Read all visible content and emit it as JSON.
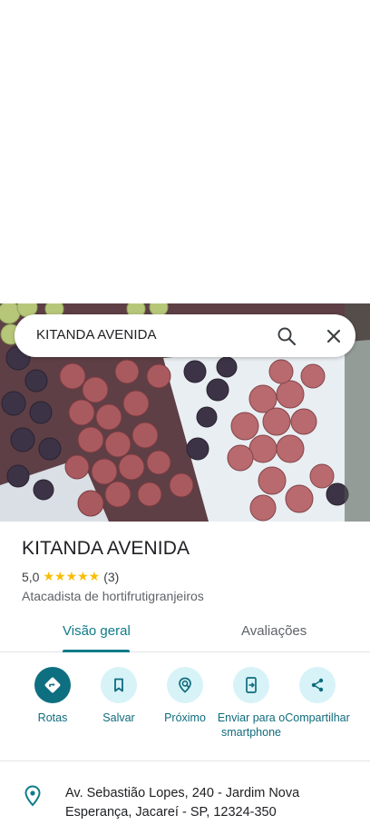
{
  "search": {
    "query": "KITANDA AVENIDA"
  },
  "place": {
    "name": "KITANDA AVENIDA",
    "rating": "5,0",
    "stars": "★★★★★",
    "review_count": "(3)",
    "category": "Atacadista de hortifrutigranjeiros"
  },
  "tabs": [
    {
      "label": "Visão geral",
      "active": true
    },
    {
      "label": "Avaliações",
      "active": false
    }
  ],
  "actions": [
    {
      "label": "Rotas",
      "icon": "directions-icon"
    },
    {
      "label": "Salvar",
      "icon": "bookmark-icon"
    },
    {
      "label": "Próximo",
      "icon": "nearby-icon"
    },
    {
      "label": "Enviar para o smartphone",
      "icon": "send-to-phone-icon"
    },
    {
      "label": "Compartilhar",
      "icon": "share-icon"
    }
  ],
  "address": {
    "text": "Av. Sebastião Lopes, 240 - Jardim Nova Esperança, Jacareí - SP, 12324-350",
    "icon": "location-pin-icon"
  },
  "colors": {
    "accent": "#0f7b8a",
    "star": "#fbbc04",
    "action_bg": "#d7f3f8",
    "primary_action_bg": "#0e6f80"
  }
}
